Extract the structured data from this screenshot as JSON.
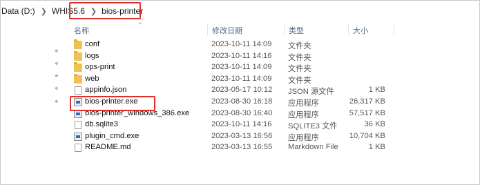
{
  "breadcrumb": {
    "items": [
      "Data (D:)",
      "WHIS5.6",
      "bios-printer"
    ]
  },
  "columns": {
    "name": "名称",
    "date": "修改日期",
    "type": "类型",
    "size": "大小"
  },
  "files": [
    {
      "name": "conf",
      "date": "2023-10-11 14:09",
      "type": "文件夹",
      "size": "",
      "icon": "folder-icon"
    },
    {
      "name": "logs",
      "date": "2023-10-11 14:16",
      "type": "文件夹",
      "size": "",
      "icon": "folder-icon"
    },
    {
      "name": "ops-print",
      "date": "2023-10-11 14:09",
      "type": "文件夹",
      "size": "",
      "icon": "folder-icon"
    },
    {
      "name": "web",
      "date": "2023-10-11 14:09",
      "type": "文件夹",
      "size": "",
      "icon": "folder-icon"
    },
    {
      "name": "appinfo.json",
      "date": "2023-05-17 10:12",
      "type": "JSON 源文件",
      "size": "1 KB",
      "icon": "json-file-icon"
    },
    {
      "name": "bios-printer.exe",
      "date": "2023-08-30 16:18",
      "type": "应用程序",
      "size": "26,317 KB",
      "icon": "exe-icon"
    },
    {
      "name": "bios-printer_windows_386.exe",
      "date": "2023-08-30 16:40",
      "type": "应用程序",
      "size": "57,517 KB",
      "icon": "exe-icon"
    },
    {
      "name": "db.sqlite3",
      "date": "2023-10-11 14:16",
      "type": "SQLITE3 文件",
      "size": "36 KB",
      "icon": "file-icon"
    },
    {
      "name": "plugin_cmd.exe",
      "date": "2023-03-13 16:56",
      "type": "应用程序",
      "size": "10,704 KB",
      "icon": "exe-icon"
    },
    {
      "name": "README.md",
      "date": "2023-03-13 16:55",
      "type": "Markdown File",
      "size": "1 KB",
      "icon": "file-icon"
    }
  ],
  "pins": [
    "pin-icon",
    "pin-icon",
    "pin-icon",
    "pin-icon",
    "pin-icon"
  ],
  "colors": {
    "highlight": "#e0302a",
    "folder": "#f2c14e",
    "header_text": "#4a6a8a"
  }
}
